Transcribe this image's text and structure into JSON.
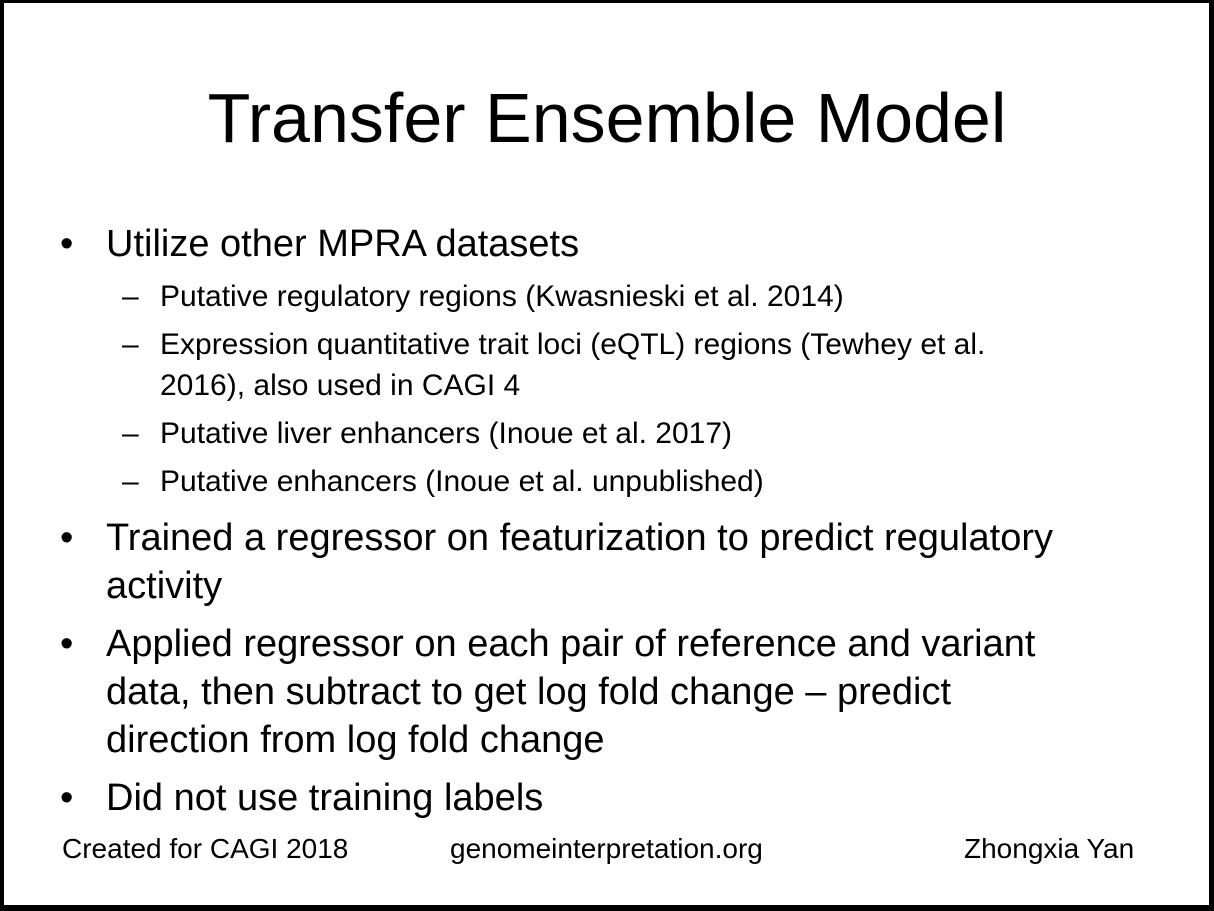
{
  "slide": {
    "title": "Transfer Ensemble Model",
    "bullets": [
      {
        "marker": "•",
        "text": "Utilize other MPRA datasets",
        "sub": [
          {
            "marker": "–",
            "text": "Putative regulatory regions (Kwasnieski et al. 2014)"
          },
          {
            "marker": "–",
            "text_line1": "Expression quantitative trait loci (eQTL) regions (Tewhey et al.",
            "text_line2": "2016), also used in CAGI 4"
          },
          {
            "marker": "–",
            "text": "Putative liver enhancers (Inoue et al. 2017)"
          },
          {
            "marker": "–",
            "text": "Putative enhancers (Inoue et al. unpublished)"
          }
        ]
      },
      {
        "marker": "•",
        "text_line1": "Trained a regressor on featurization to predict regulatory",
        "text_line2": "activity"
      },
      {
        "marker": "•",
        "text_line1": "Applied regressor on each pair of reference and variant",
        "text_line2": "data, then subtract to get log fold change – predict",
        "text_line3": "direction from log fold change"
      },
      {
        "marker": "•",
        "text": "Did not use training labels"
      }
    ],
    "footer": {
      "left": "Created for CAGI 2018",
      "center": "genomeinterpretation.org",
      "right": "Zhongxia Yan"
    }
  }
}
